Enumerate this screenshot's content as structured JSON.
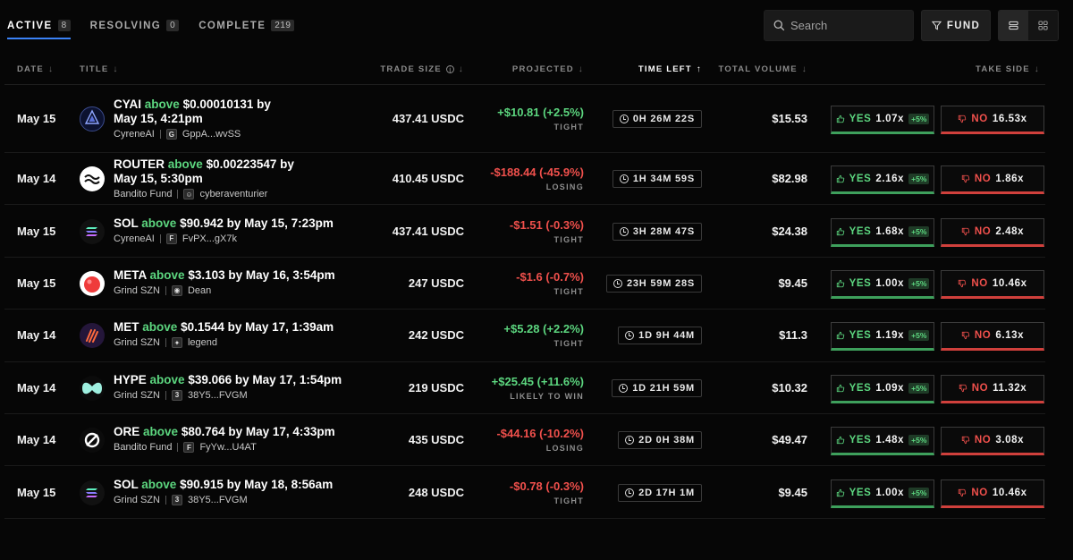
{
  "tabs": [
    {
      "label": "ACTIVE",
      "count": "8",
      "active": true
    },
    {
      "label": "RESOLVING",
      "count": "0",
      "active": false
    },
    {
      "label": "COMPLETE",
      "count": "219",
      "active": false
    }
  ],
  "search": {
    "placeholder": "Search"
  },
  "fund_label": "FUND",
  "headers": {
    "date": "DATE",
    "title": "TITLE",
    "trade_size": "TRADE SIZE",
    "projected": "PROJECTED",
    "time_left": "TIME LEFT",
    "total_volume": "TOTAL VOLUME",
    "take_side": "TAKE SIDE"
  },
  "yes_label": "YES",
  "no_label": "NO",
  "rows": [
    {
      "date": "May 15",
      "token": "CYAI",
      "direction": "above",
      "target": "$0.00010131 by",
      "target2": "May 15, 4:21pm",
      "creator": "CyreneAI",
      "handle_icon": "G",
      "handle": "GppA...wvSS",
      "trade_size": "437.41 USDC",
      "projected": "+$10.81 (+2.5%)",
      "projected_sign": "pos",
      "tag": "TIGHT",
      "time_left": "0H 26M 22S",
      "volume": "$15.53",
      "yes_mult": "1.07x",
      "yes_bonus": "+5%",
      "no_mult": "16.53x",
      "logo": "cyai"
    },
    {
      "date": "May 14",
      "token": "ROUTER",
      "direction": "above",
      "target": "$0.00223547 by",
      "target2": "May 15, 5:30pm",
      "creator": "Bandito Fund",
      "handle_icon": "☺",
      "handle": "cyberaventurier",
      "trade_size": "410.45 USDC",
      "projected": "-$188.44 (-45.9%)",
      "projected_sign": "neg",
      "tag": "LOSING",
      "time_left": "1H 34M 59S",
      "volume": "$82.98",
      "yes_mult": "2.16x",
      "yes_bonus": "+5%",
      "no_mult": "1.86x",
      "logo": "router"
    },
    {
      "date": "May 15",
      "token": "SOL",
      "direction": "above",
      "target": "$90.942 by May 15, 7:23pm",
      "target2": "",
      "creator": "CyreneAI",
      "handle_icon": "F",
      "handle": "FvPX...gX7k",
      "trade_size": "437.41 USDC",
      "projected": "-$1.51 (-0.3%)",
      "projected_sign": "neg",
      "tag": "TIGHT",
      "time_left": "3H 28M 47S",
      "volume": "$24.38",
      "yes_mult": "1.68x",
      "yes_bonus": "+5%",
      "no_mult": "2.48x",
      "logo": "sol"
    },
    {
      "date": "May 15",
      "token": "META",
      "direction": "above",
      "target": "$3.103 by May 16, 3:54pm",
      "target2": "",
      "creator": "Grind SZN",
      "handle_icon": "◉",
      "handle": "Dean",
      "trade_size": "247 USDC",
      "projected": "-$1.6 (-0.7%)",
      "projected_sign": "neg",
      "tag": "TIGHT",
      "time_left": "23H 59M 28S",
      "volume": "$9.45",
      "yes_mult": "1.00x",
      "yes_bonus": "+5%",
      "no_mult": "10.46x",
      "logo": "meta"
    },
    {
      "date": "May 14",
      "token": "MET",
      "direction": "above",
      "target": "$0.1544 by May 17, 1:39am",
      "target2": "",
      "creator": "Grind SZN",
      "handle_icon": "✦",
      "handle": "legend",
      "trade_size": "242 USDC",
      "projected": "+$5.28 (+2.2%)",
      "projected_sign": "pos",
      "tag": "TIGHT",
      "time_left": "1D 9H 44M",
      "volume": "$11.3",
      "yes_mult": "1.19x",
      "yes_bonus": "+5%",
      "no_mult": "6.13x",
      "logo": "met"
    },
    {
      "date": "May 14",
      "token": "HYPE",
      "direction": "above",
      "target": "$39.066 by May 17, 1:54pm",
      "target2": "",
      "creator": "Grind SZN",
      "handle_icon": "3",
      "handle": "38Y5...FVGM",
      "trade_size": "219 USDC",
      "projected": "+$25.45 (+11.6%)",
      "projected_sign": "pos",
      "tag": "LIKELY TO WIN",
      "time_left": "1D 21H 59M",
      "volume": "$10.32",
      "yes_mult": "1.09x",
      "yes_bonus": "+5%",
      "no_mult": "11.32x",
      "logo": "hype"
    },
    {
      "date": "May 14",
      "token": "ORE",
      "direction": "above",
      "target": "$80.764 by May 17, 4:33pm",
      "target2": "",
      "creator": "Bandito Fund",
      "handle_icon": "F",
      "handle": "FyYw...U4AT",
      "trade_size": "435 USDC",
      "projected": "-$44.16 (-10.2%)",
      "projected_sign": "neg",
      "tag": "LOSING",
      "time_left": "2D 0H 38M",
      "volume": "$49.47",
      "yes_mult": "1.48x",
      "yes_bonus": "+5%",
      "no_mult": "3.08x",
      "logo": "ore"
    },
    {
      "date": "May 15",
      "token": "SOL",
      "direction": "above",
      "target": "$90.915 by May 18, 8:56am",
      "target2": "",
      "creator": "Grind SZN",
      "handle_icon": "3",
      "handle": "38Y5...FVGM",
      "trade_size": "248 USDC",
      "projected": "-$0.78 (-0.3%)",
      "projected_sign": "neg",
      "tag": "TIGHT",
      "time_left": "2D 17H 1M",
      "volume": "$9.45",
      "yes_mult": "1.00x",
      "yes_bonus": "+5%",
      "no_mult": "10.46x",
      "logo": "sol"
    }
  ],
  "colors": {
    "accent_blue": "#3b82f6",
    "green": "#5cd67f",
    "red": "#f0504c",
    "background": "#060606"
  }
}
